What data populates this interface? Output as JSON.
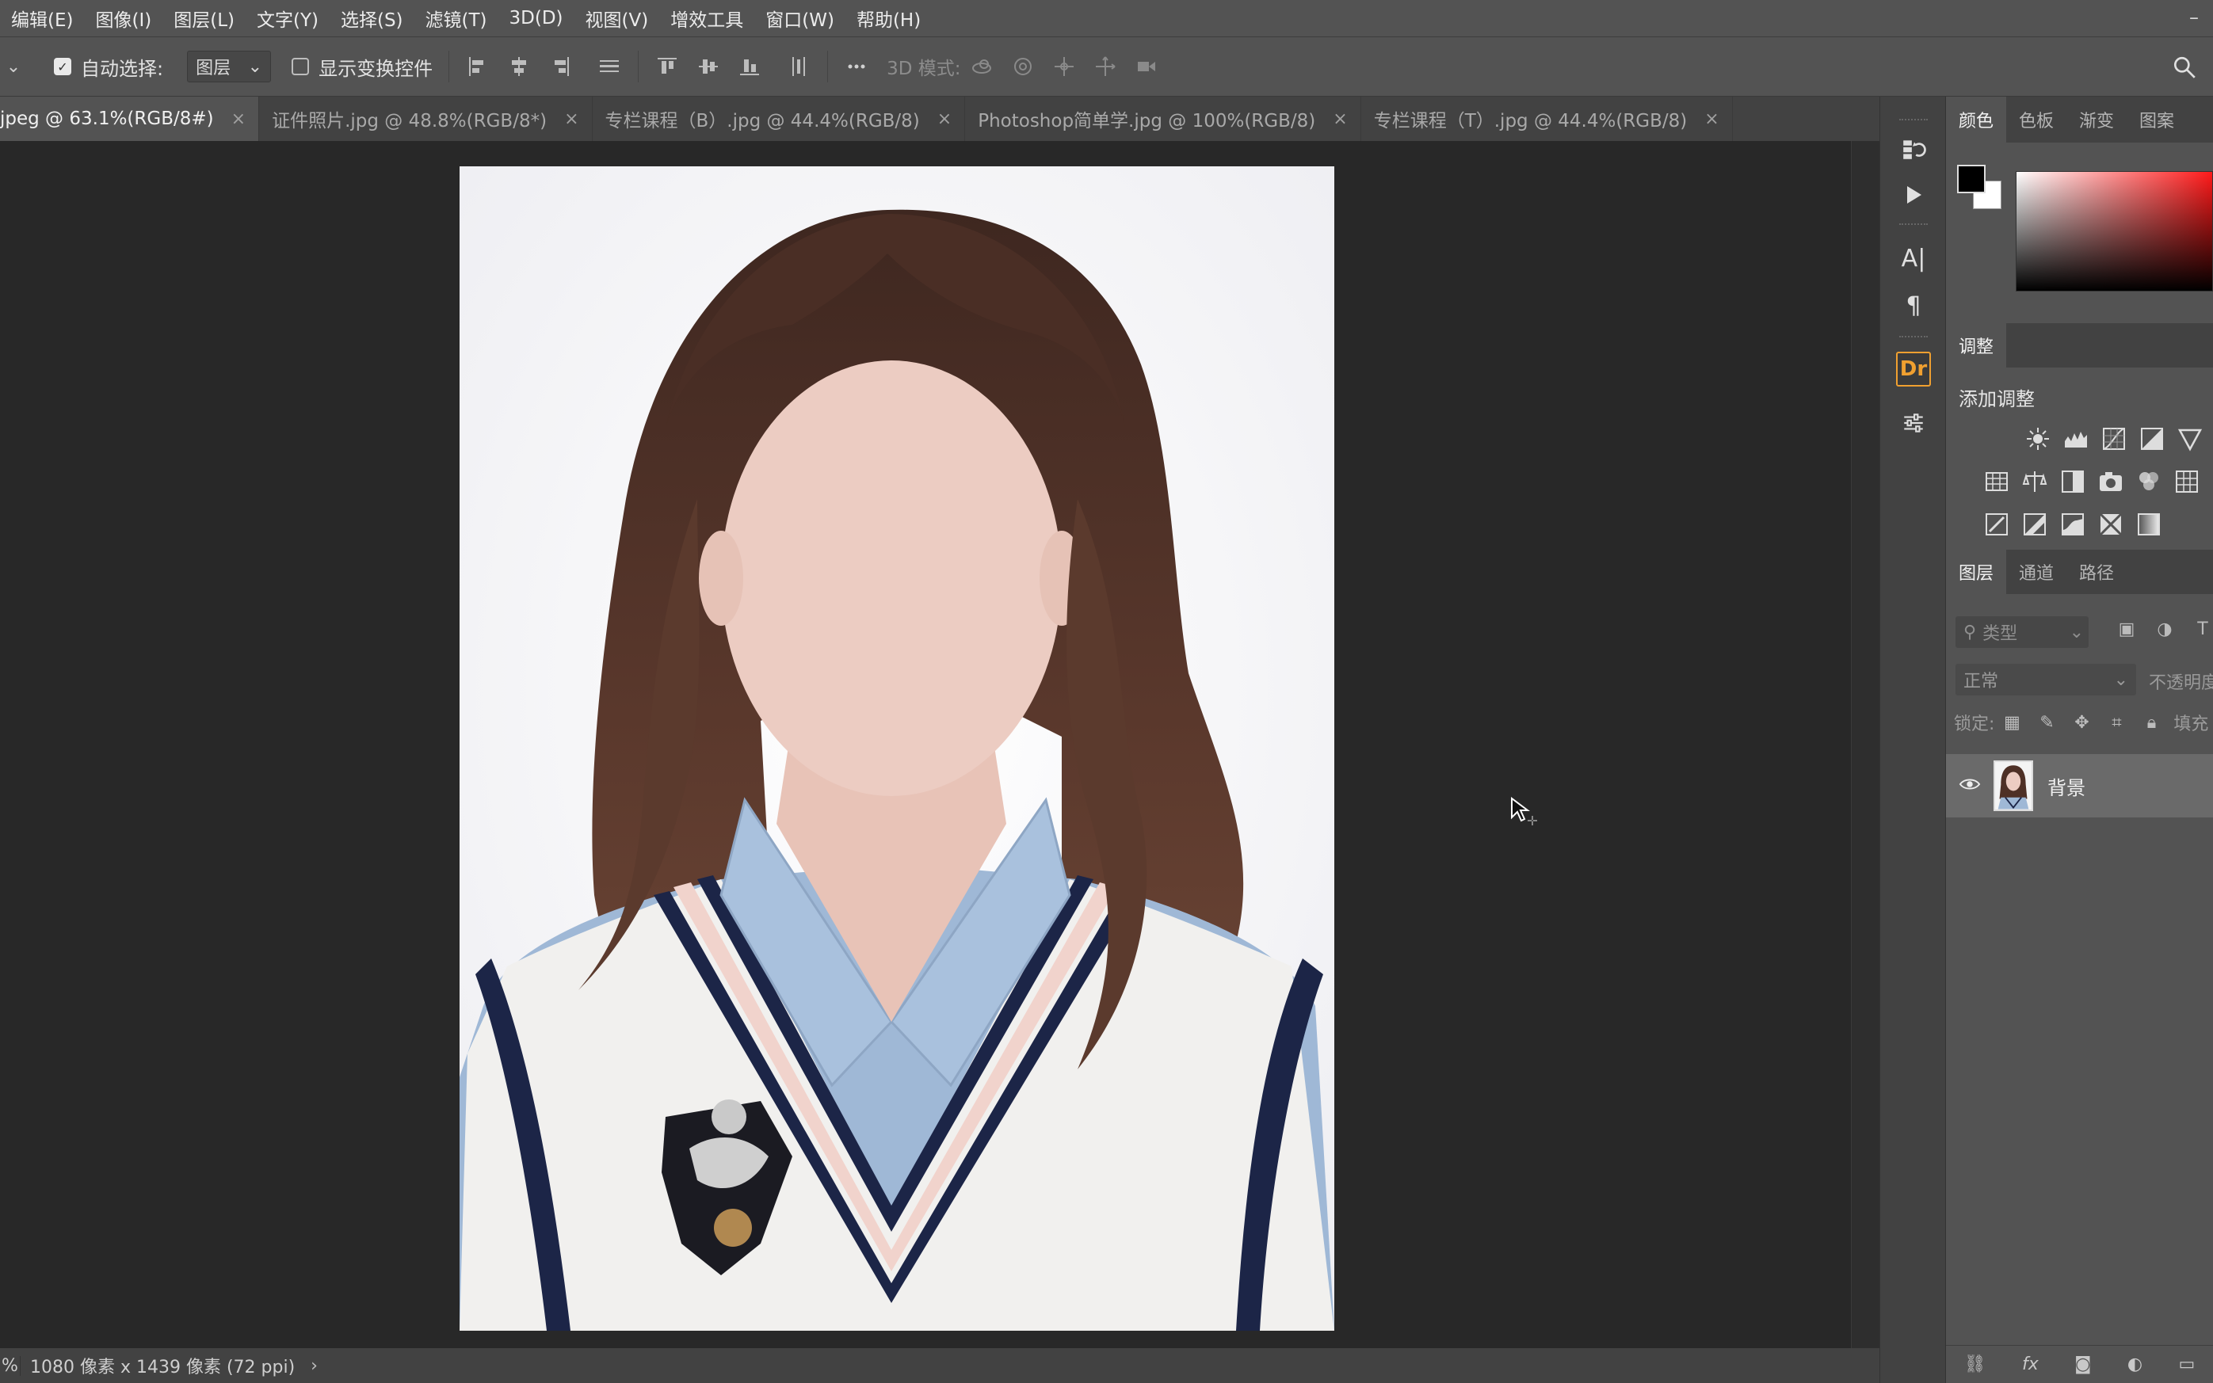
{
  "menu": [
    "编辑(E)",
    "图像(I)",
    "图层(L)",
    "文字(Y)",
    "选择(S)",
    "滤镜(T)",
    "3D(D)",
    "视图(V)",
    "增效工具",
    "窗口(W)",
    "帮助(H)"
  ],
  "options": {
    "auto_select_label": "自动选择:",
    "auto_select_checked": true,
    "auto_select_target": "图层",
    "show_transform_label": "显示变换控件",
    "show_transform_checked": false,
    "mode_3d_label": "3D 模式:"
  },
  "tabs": [
    {
      "label": "jpeg @ 63.1%(RGB/8#)",
      "active": true
    },
    {
      "label": "证件照片.jpg @ 48.8%(RGB/8*)",
      "active": false
    },
    {
      "label": "专栏课程（B）.jpg @ 44.4%(RGB/8)",
      "active": false
    },
    {
      "label": "Photoshop简单学.jpg @ 100%(RGB/8)",
      "active": false
    },
    {
      "label": "专栏课程（T）.jpg @ 44.4%(RGB/8)",
      "active": false
    }
  ],
  "status": {
    "zoom": "%",
    "doc_info": "1080 像素 x 1439 像素 (72 ppi)",
    "arrow": "›"
  },
  "panels": {
    "color_tabs": [
      "颜色",
      "色板",
      "渐变",
      "图案"
    ],
    "foreground": "#000000",
    "background": "#ffffff",
    "adjust_tab": "调整",
    "adjust_title": "添加调整",
    "layers_tabs": [
      "图层",
      "通道",
      "路径"
    ],
    "layer_filter_placeholder": "类型",
    "blend_mode": "正常",
    "opacity_label": "不透明度",
    "lock_label": "锁定:",
    "fill_label": "填充",
    "layers": [
      {
        "name": "背景",
        "visible": true
      }
    ]
  },
  "colors": {
    "skin": "#ecccc2",
    "hair": "#4e3026",
    "shirt": "#9fb8d6",
    "vest": "#f1f0ee",
    "trim_navy": "#1c2547",
    "trim_pink": "#f1d3cc",
    "accent_orange": "#f0a030"
  }
}
